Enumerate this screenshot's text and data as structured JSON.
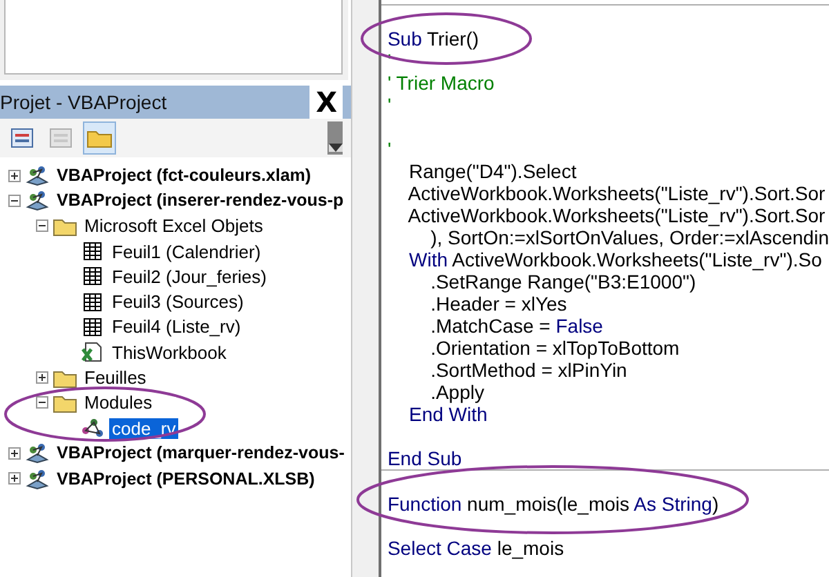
{
  "project_explorer": {
    "title": "Projet - VBAProject",
    "close": "X",
    "toolbar": [
      {
        "kind": "code",
        "selected": false,
        "disabled": false
      },
      {
        "kind": "object",
        "selected": false,
        "disabled": true
      },
      {
        "kind": "folders",
        "selected": true,
        "disabled": false
      }
    ],
    "tree": [
      {
        "label": "VBAProject (fct-couleurs.xlam)",
        "kind": "project",
        "expanded": false,
        "selected": false
      },
      {
        "label": "VBAProject (inserer-rendez-vous-p",
        "kind": "project",
        "expanded": true,
        "selected": false,
        "children": [
          {
            "label": "Microsoft Excel Objets",
            "kind": "folder",
            "expanded": true,
            "selected": false,
            "children": [
              {
                "label": "Feuil1 (Calendrier)",
                "kind": "sheet",
                "selected": false
              },
              {
                "label": "Feuil2 (Jour_feries)",
                "kind": "sheet",
                "selected": false
              },
              {
                "label": "Feuil3 (Sources)",
                "kind": "sheet",
                "selected": false
              },
              {
                "label": "Feuil4 (Liste_rv)",
                "kind": "sheet",
                "selected": false
              },
              {
                "label": "ThisWorkbook",
                "kind": "workbook",
                "selected": false
              }
            ]
          },
          {
            "label": "Feuilles",
            "kind": "folder",
            "expanded": false,
            "selected": false
          },
          {
            "label": "Modules",
            "kind": "folder",
            "expanded": true,
            "selected": false,
            "children": [
              {
                "label": "code_rv",
                "kind": "module",
                "selected": true
              }
            ]
          }
        ]
      },
      {
        "label": "VBAProject (marquer-rendez-vous-",
        "kind": "project",
        "expanded": false,
        "selected": false
      },
      {
        "label": "VBAProject (PERSONAL.XLSB)",
        "kind": "project",
        "expanded": false,
        "selected": false
      }
    ]
  },
  "code_window": {
    "lines": [
      {
        "kind": "separator"
      },
      {
        "kind": "blank"
      },
      {
        "kind": "code",
        "segments": [
          {
            "text": "Sub",
            "kind": "keyword"
          },
          {
            "text": " Trier()",
            "kind": "plain"
          }
        ]
      },
      {
        "kind": "code",
        "segments": [
          {
            "text": "'",
            "kind": "comment"
          }
        ]
      },
      {
        "kind": "code",
        "segments": [
          {
            "text": "' Trier Macro",
            "kind": "comment"
          }
        ]
      },
      {
        "kind": "code",
        "segments": [
          {
            "text": "'",
            "kind": "comment"
          }
        ]
      },
      {
        "kind": "blank"
      },
      {
        "kind": "code",
        "segments": [
          {
            "text": "'",
            "kind": "comment"
          }
        ]
      },
      {
        "kind": "code",
        "segments": [
          {
            "text": "    Range(\"D4\").Select",
            "kind": "plain"
          }
        ]
      },
      {
        "kind": "code",
        "segments": [
          {
            "text": "    ActiveWorkbook.Worksheets(\"Liste_rv\").Sort.Sor",
            "kind": "plain"
          }
        ]
      },
      {
        "kind": "code",
        "segments": [
          {
            "text": "    ActiveWorkbook.Worksheets(\"Liste_rv\").Sort.Sor",
            "kind": "plain"
          }
        ]
      },
      {
        "kind": "code",
        "segments": [
          {
            "text": "        ), SortOn:=xlSortOnValues, Order:=xlAscendin",
            "kind": "plain"
          }
        ]
      },
      {
        "kind": "code",
        "segments": [
          {
            "text": "    With",
            "kind": "keyword"
          },
          {
            "text": " ActiveWorkbook.Worksheets(\"Liste_rv\").So",
            "kind": "plain"
          }
        ]
      },
      {
        "kind": "code",
        "segments": [
          {
            "text": "        .SetRange Range(\"B3:E1000\")",
            "kind": "plain"
          }
        ]
      },
      {
        "kind": "code",
        "segments": [
          {
            "text": "        .Header = xlYes",
            "kind": "plain"
          }
        ]
      },
      {
        "kind": "code",
        "segments": [
          {
            "text": "        .MatchCase = ",
            "kind": "plain"
          },
          {
            "text": "False",
            "kind": "keyword"
          }
        ]
      },
      {
        "kind": "code",
        "segments": [
          {
            "text": "        .Orientation = xlTopToBottom",
            "kind": "plain"
          }
        ]
      },
      {
        "kind": "code",
        "segments": [
          {
            "text": "        .SortMethod = xlPinYin",
            "kind": "plain"
          }
        ]
      },
      {
        "kind": "code",
        "segments": [
          {
            "text": "        .Apply",
            "kind": "plain"
          }
        ]
      },
      {
        "kind": "code",
        "segments": [
          {
            "text": "    End With",
            "kind": "keyword"
          }
        ]
      },
      {
        "kind": "blank"
      },
      {
        "kind": "code",
        "segments": [
          {
            "text": "End Sub",
            "kind": "keyword"
          }
        ]
      },
      {
        "kind": "separator"
      },
      {
        "kind": "blank"
      },
      {
        "kind": "code",
        "segments": [
          {
            "text": "Function",
            "kind": "keyword"
          },
          {
            "text": " num_mois(le_mois ",
            "kind": "plain"
          },
          {
            "text": "As String",
            "kind": "keyword"
          },
          {
            "text": ")",
            "kind": "plain"
          }
        ]
      },
      {
        "kind": "blank"
      },
      {
        "kind": "code",
        "segments": [
          {
            "text": "Select Case",
            "kind": "keyword"
          },
          {
            "text": " le_mois",
            "kind": "plain"
          }
        ]
      }
    ]
  }
}
